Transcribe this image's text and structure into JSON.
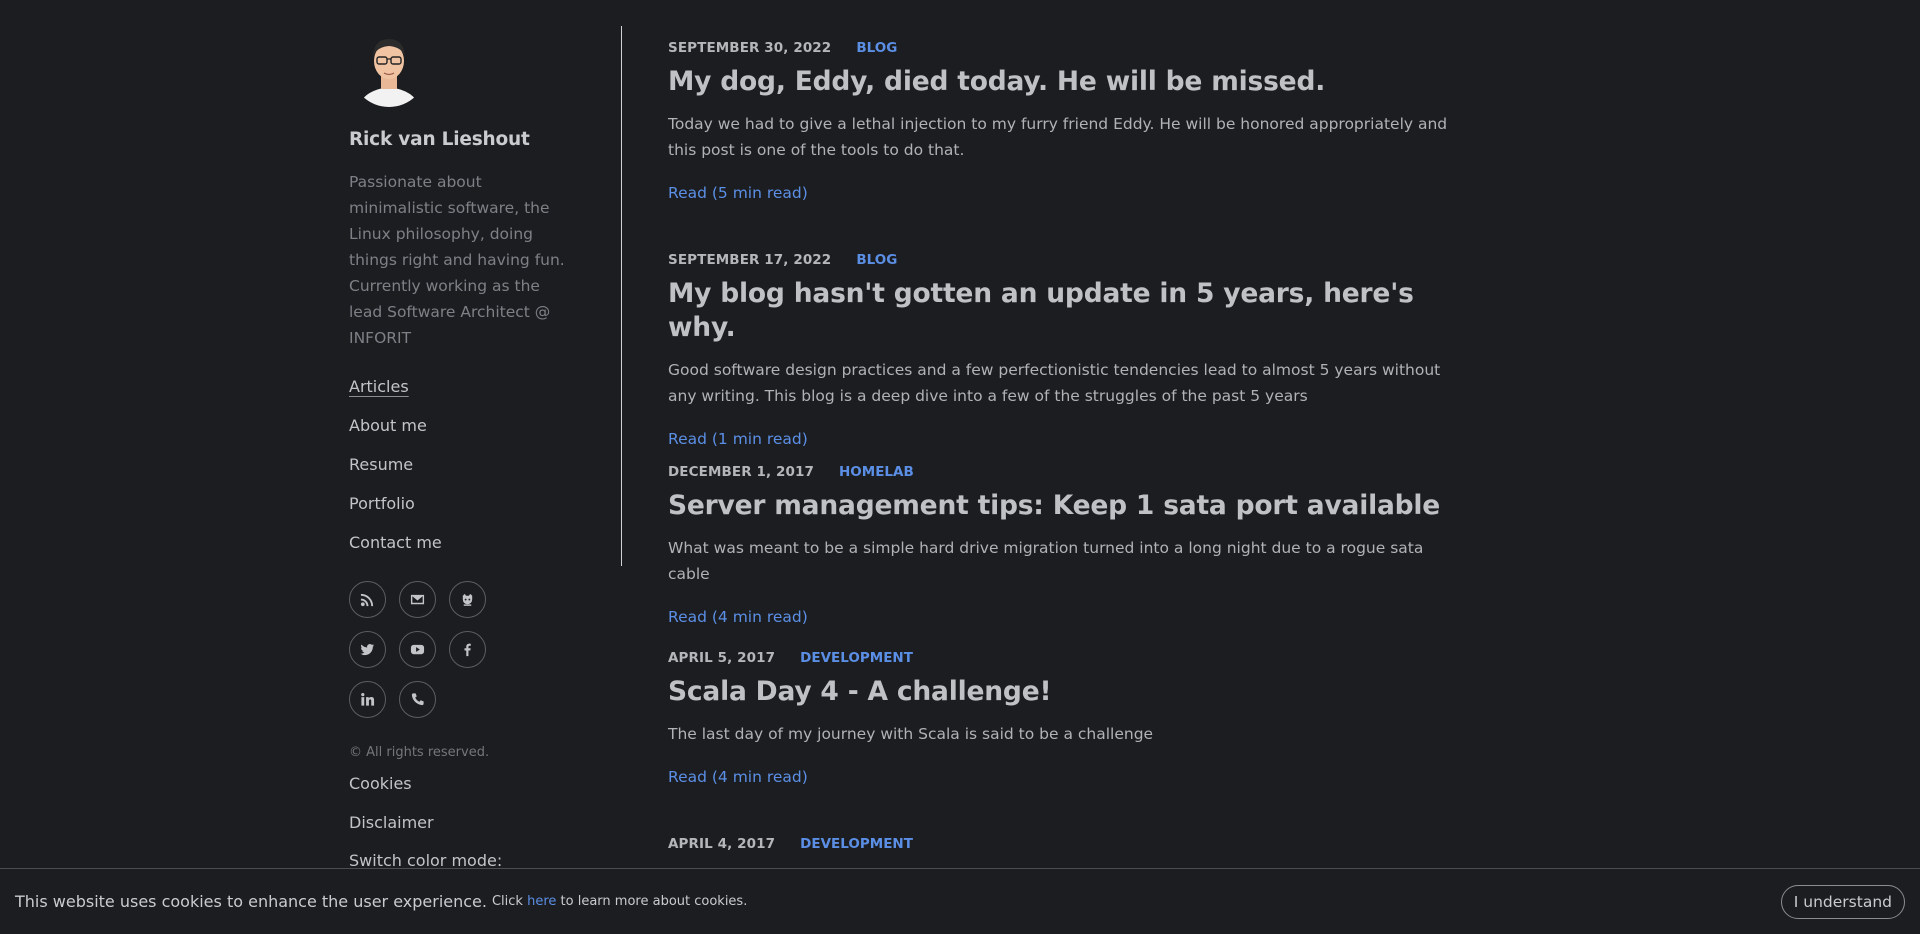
{
  "author": {
    "name": "Rick van Lieshout",
    "bio": "Passionate about minimalistic software, the Linux philosophy, doing things right and having fun. Currently working as the lead Software Architect @ INFORIT"
  },
  "nav": [
    {
      "label": "Articles",
      "active": true
    },
    {
      "label": "About me"
    },
    {
      "label": "Resume"
    },
    {
      "label": "Portfolio"
    },
    {
      "label": "Contact me"
    }
  ],
  "socials": [
    "rss-icon",
    "email-icon",
    "github-icon",
    "twitter-icon",
    "youtube-icon",
    "facebook-icon",
    "linkedin-icon",
    "phone-icon"
  ],
  "footer": {
    "copyright": "© All rights reserved.",
    "links": [
      "Cookies",
      "Disclaimer"
    ],
    "switch_label": "Switch color mode:"
  },
  "posts": [
    {
      "date": "SEPTEMBER 30, 2022",
      "tag": "BLOG",
      "title": "My dog, Eddy, died today. He will be missed.",
      "excerpt": "Today we had to give a lethal injection to my furry friend Eddy. He will be honored appropriately and this post is one of the tools to do that.",
      "read": "Read (5 min read)"
    },
    {
      "date": "SEPTEMBER 17, 2022",
      "tag": "BLOG",
      "title": "My blog hasn't gotten an update in 5 years, here's why.",
      "excerpt": "Good software design practices and a few perfectionistic tendencies lead to almost 5 years without any writing. This blog is a deep dive into a few of the struggles of the past 5 years",
      "read": "Read (1 min read)"
    },
    {
      "date": "DECEMBER 1, 2017",
      "tag": "HOMELAB",
      "title": "Server management tips: Keep 1 sata port available",
      "excerpt": "What was meant to be a simple hard drive migration turned into a long night due to a rogue sata cable",
      "read": "Read (4 min read)"
    },
    {
      "date": "APRIL 5, 2017",
      "tag": "DEVELOPMENT",
      "title": "Scala Day 4 - A challenge!",
      "excerpt": "The last day of my journey with Scala is said to be a challenge",
      "read": "Read (4 min read)"
    },
    {
      "date": "APRIL 4, 2017",
      "tag": "DEVELOPMENT"
    }
  ],
  "cookie": {
    "main": "This website uses cookies to enhance the user experience.",
    "sub_before": "Click",
    "link": "here",
    "sub_after": "to learn more about cookies.",
    "button": "I understand"
  },
  "colors": {
    "background": "#1c1d20",
    "accent": "#5b8fe6"
  }
}
